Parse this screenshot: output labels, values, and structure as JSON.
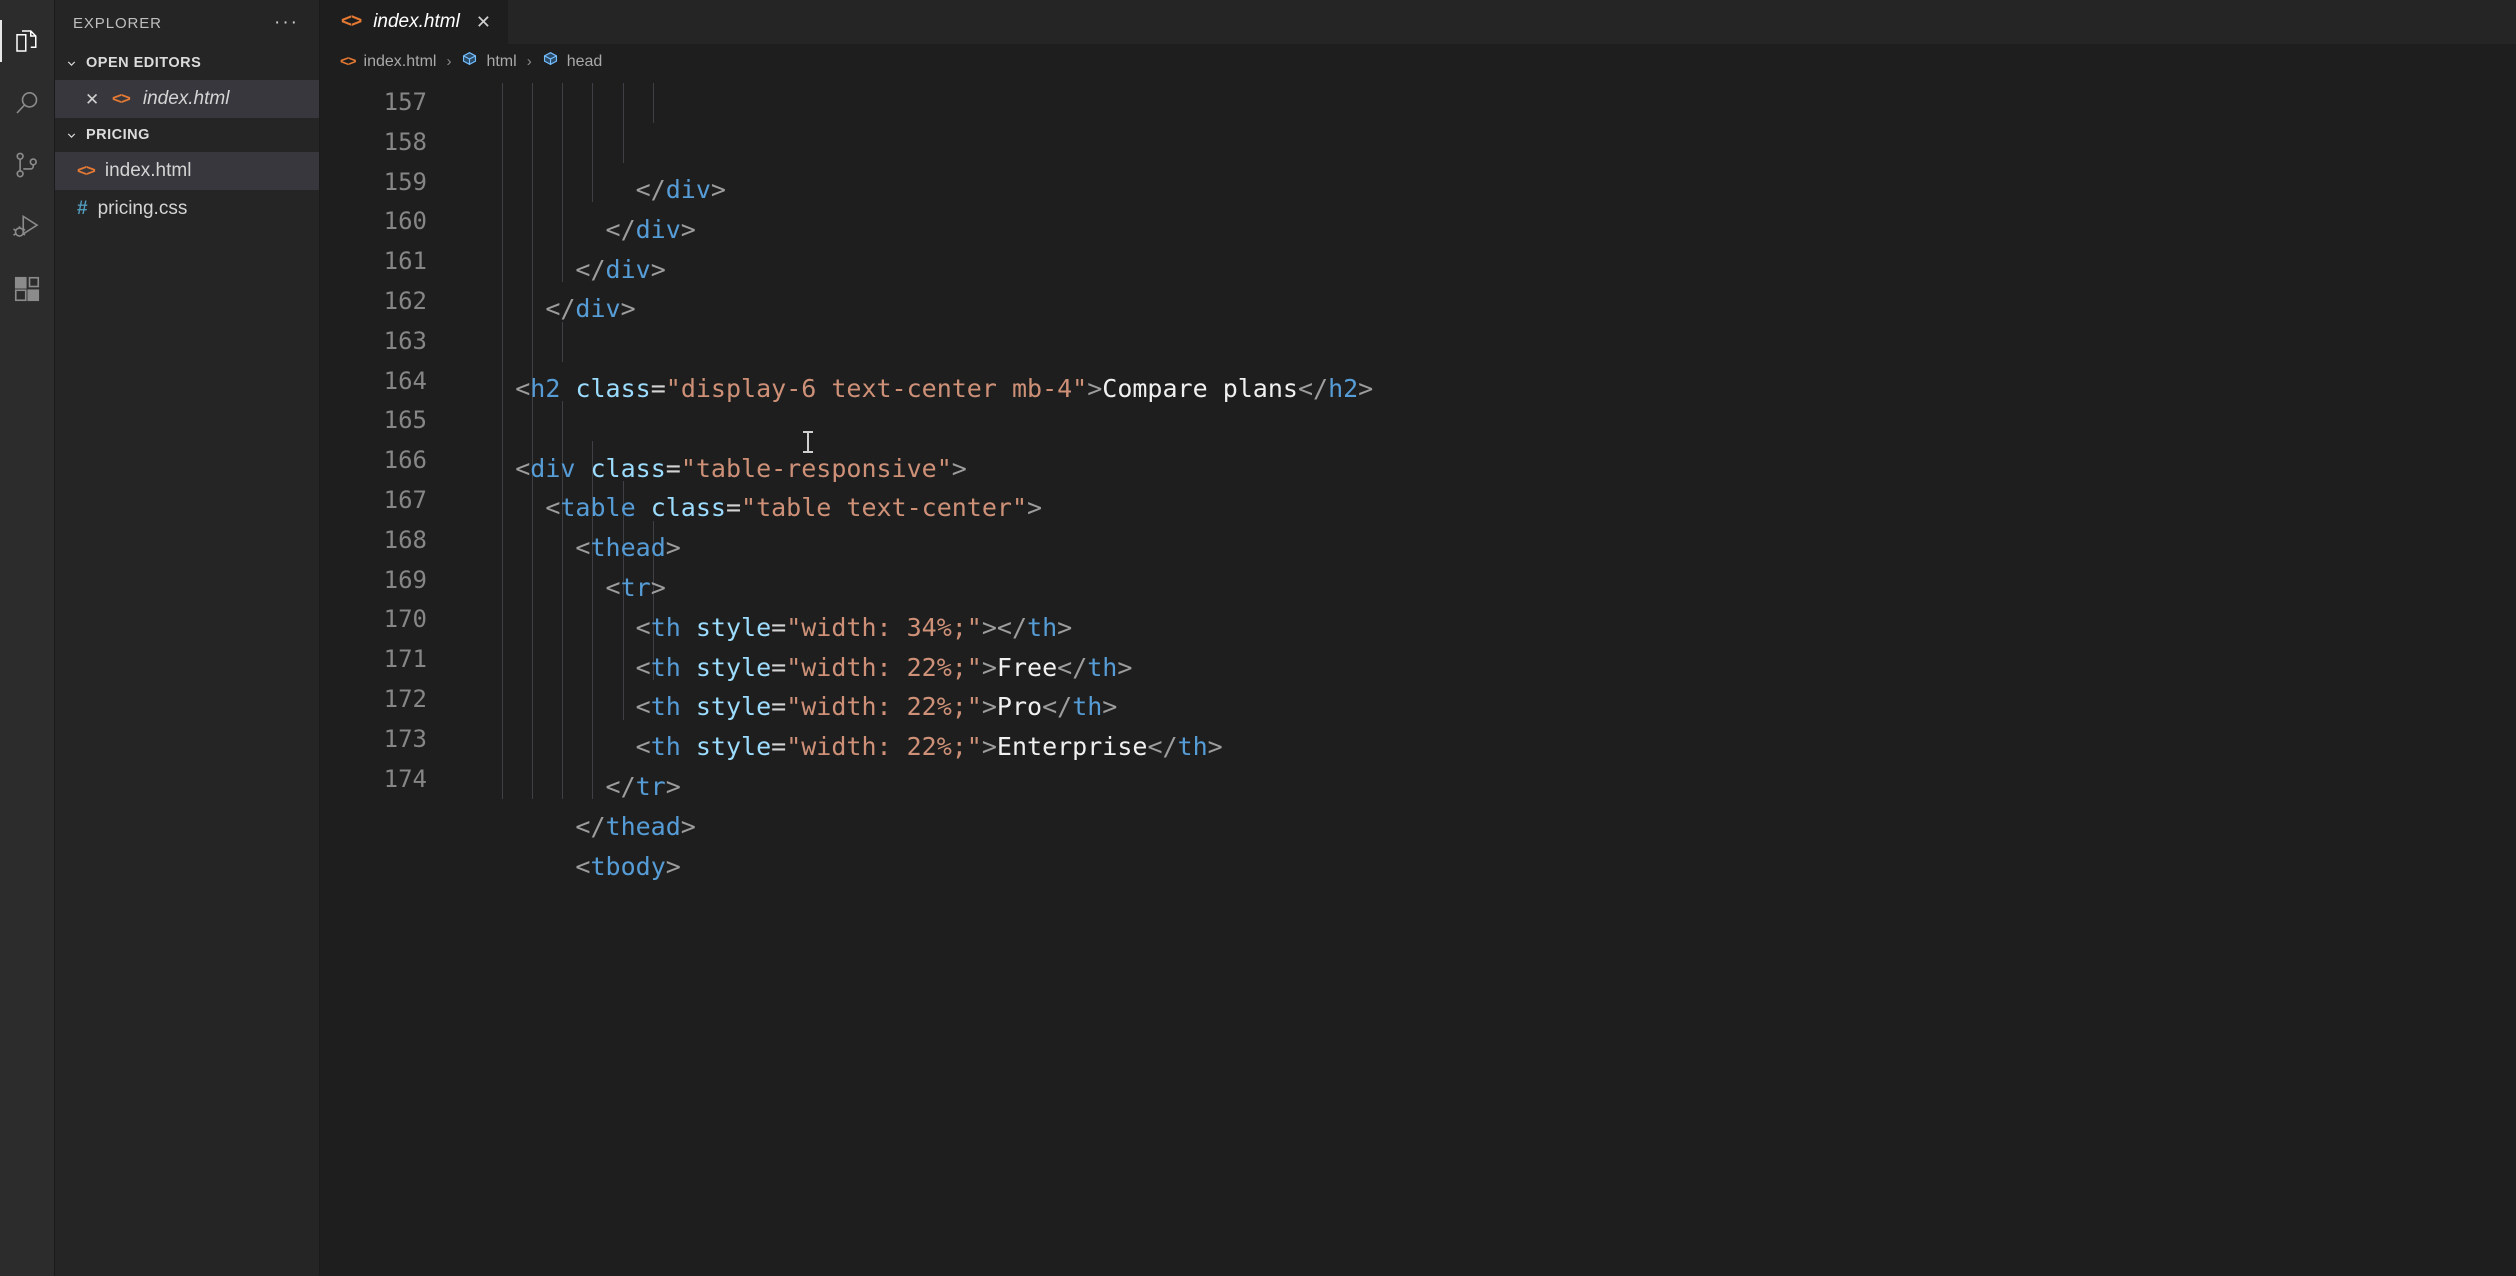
{
  "activitybar": {
    "items": [
      {
        "name": "explorer",
        "icon": "files-icon",
        "active": true
      },
      {
        "name": "search",
        "icon": "search-icon",
        "active": false
      },
      {
        "name": "source-control",
        "icon": "source-control-icon",
        "active": false
      },
      {
        "name": "run-and-debug",
        "icon": "run-debug-icon",
        "active": false
      },
      {
        "name": "extensions",
        "icon": "extensions-icon",
        "active": false
      }
    ]
  },
  "sidebar": {
    "title": "EXPLORER",
    "more_actions": "···",
    "sections": [
      {
        "label": "OPEN EDITORS",
        "expanded": true,
        "items": [
          {
            "label": "index.html",
            "icon": "html-file-icon",
            "close": "✕",
            "selected": true,
            "italic": true
          }
        ]
      },
      {
        "label": "PRICING",
        "expanded": true,
        "items": [
          {
            "label": "index.html",
            "icon": "html-file-icon",
            "selected": true
          },
          {
            "label": "pricing.css",
            "icon": "css-file-icon",
            "selected": false
          }
        ]
      }
    ]
  },
  "editor": {
    "tab": {
      "label": "index.html",
      "icon": "html-file-icon",
      "close": "✕",
      "dirty": false
    },
    "breadcrumb": [
      {
        "label": "index.html",
        "icon": "html-file-icon"
      },
      {
        "label": "html",
        "icon": "symbol-cube-icon"
      },
      {
        "label": "head",
        "icon": "symbol-cube-icon"
      }
    ],
    "breadcrumb_separator": "›",
    "language": "html",
    "first_visible_line": 157,
    "lines": [
      {
        "n": "157",
        "indent": 6,
        "tokens": [
          {
            "t": "brk",
            "v": "</"
          },
          {
            "t": "tag",
            "v": "div"
          },
          {
            "t": "brk",
            "v": ">"
          }
        ]
      },
      {
        "n": "158",
        "indent": 5,
        "tokens": [
          {
            "t": "brk",
            "v": "</"
          },
          {
            "t": "tag",
            "v": "div"
          },
          {
            "t": "brk",
            "v": ">"
          }
        ]
      },
      {
        "n": "159",
        "indent": 4,
        "tokens": [
          {
            "t": "brk",
            "v": "</"
          },
          {
            "t": "tag",
            "v": "div"
          },
          {
            "t": "brk",
            "v": ">"
          }
        ]
      },
      {
        "n": "160",
        "indent": 3,
        "tokens": [
          {
            "t": "brk",
            "v": "</"
          },
          {
            "t": "tag",
            "v": "div"
          },
          {
            "t": "brk",
            "v": ">"
          }
        ]
      },
      {
        "n": "161",
        "indent": 0,
        "tokens": []
      },
      {
        "n": "162",
        "indent": 2,
        "tokens": [
          {
            "t": "brk",
            "v": "<"
          },
          {
            "t": "tag",
            "v": "h2"
          },
          {
            "t": "eq",
            "v": " "
          },
          {
            "t": "attr",
            "v": "class"
          },
          {
            "t": "eq",
            "v": "="
          },
          {
            "t": "str",
            "v": "\"display-6 text-center mb-4\""
          },
          {
            "t": "brk",
            "v": ">"
          },
          {
            "t": "txt",
            "v": "Compare plans"
          },
          {
            "t": "brk",
            "v": "</"
          },
          {
            "t": "tag",
            "v": "h2"
          },
          {
            "t": "brk",
            "v": ">"
          }
        ]
      },
      {
        "n": "163",
        "indent": 0,
        "tokens": []
      },
      {
        "n": "164",
        "indent": 2,
        "tokens": [
          {
            "t": "brk",
            "v": "<"
          },
          {
            "t": "tag",
            "v": "div"
          },
          {
            "t": "eq",
            "v": " "
          },
          {
            "t": "attr",
            "v": "class"
          },
          {
            "t": "eq",
            "v": "="
          },
          {
            "t": "str",
            "v": "\"table-responsive\""
          },
          {
            "t": "brk",
            "v": ">"
          }
        ]
      },
      {
        "n": "165",
        "indent": 3,
        "tokens": [
          {
            "t": "brk",
            "v": "<"
          },
          {
            "t": "tag",
            "v": "table"
          },
          {
            "t": "eq",
            "v": " "
          },
          {
            "t": "attr",
            "v": "class"
          },
          {
            "t": "eq",
            "v": "="
          },
          {
            "t": "str",
            "v": "\"table text-center\""
          },
          {
            "t": "brk",
            "v": ">"
          }
        ]
      },
      {
        "n": "166",
        "indent": 4,
        "tokens": [
          {
            "t": "brk",
            "v": "<"
          },
          {
            "t": "tag",
            "v": "thead"
          },
          {
            "t": "brk",
            "v": ">"
          }
        ]
      },
      {
        "n": "167",
        "indent": 5,
        "tokens": [
          {
            "t": "brk",
            "v": "<"
          },
          {
            "t": "tag",
            "v": "tr"
          },
          {
            "t": "brk",
            "v": ">"
          }
        ]
      },
      {
        "n": "168",
        "indent": 6,
        "tokens": [
          {
            "t": "brk",
            "v": "<"
          },
          {
            "t": "tag",
            "v": "th"
          },
          {
            "t": "eq",
            "v": " "
          },
          {
            "t": "attr",
            "v": "style"
          },
          {
            "t": "eq",
            "v": "="
          },
          {
            "t": "str",
            "v": "\"width: 34%;\""
          },
          {
            "t": "brk",
            "v": ">"
          },
          {
            "t": "brk",
            "v": "</"
          },
          {
            "t": "tag",
            "v": "th"
          },
          {
            "t": "brk",
            "v": ">"
          }
        ]
      },
      {
        "n": "169",
        "indent": 6,
        "tokens": [
          {
            "t": "brk",
            "v": "<"
          },
          {
            "t": "tag",
            "v": "th"
          },
          {
            "t": "eq",
            "v": " "
          },
          {
            "t": "attr",
            "v": "style"
          },
          {
            "t": "eq",
            "v": "="
          },
          {
            "t": "str",
            "v": "\"width: 22%;\""
          },
          {
            "t": "brk",
            "v": ">"
          },
          {
            "t": "txt",
            "v": "Free"
          },
          {
            "t": "brk",
            "v": "</"
          },
          {
            "t": "tag",
            "v": "th"
          },
          {
            "t": "brk",
            "v": ">"
          }
        ]
      },
      {
        "n": "170",
        "indent": 6,
        "tokens": [
          {
            "t": "brk",
            "v": "<"
          },
          {
            "t": "tag",
            "v": "th"
          },
          {
            "t": "eq",
            "v": " "
          },
          {
            "t": "attr",
            "v": "style"
          },
          {
            "t": "eq",
            "v": "="
          },
          {
            "t": "str",
            "v": "\"width: 22%;\""
          },
          {
            "t": "brk",
            "v": ">"
          },
          {
            "t": "txt",
            "v": "Pro"
          },
          {
            "t": "brk",
            "v": "</"
          },
          {
            "t": "tag",
            "v": "th"
          },
          {
            "t": "brk",
            "v": ">"
          }
        ]
      },
      {
        "n": "171",
        "indent": 6,
        "tokens": [
          {
            "t": "brk",
            "v": "<"
          },
          {
            "t": "tag",
            "v": "th"
          },
          {
            "t": "eq",
            "v": " "
          },
          {
            "t": "attr",
            "v": "style"
          },
          {
            "t": "eq",
            "v": "="
          },
          {
            "t": "str",
            "v": "\"width: 22%;\""
          },
          {
            "t": "brk",
            "v": ">"
          },
          {
            "t": "txt",
            "v": "Enterprise"
          },
          {
            "t": "brk",
            "v": "</"
          },
          {
            "t": "tag",
            "v": "th"
          },
          {
            "t": "brk",
            "v": ">"
          }
        ]
      },
      {
        "n": "172",
        "indent": 5,
        "tokens": [
          {
            "t": "brk",
            "v": "</"
          },
          {
            "t": "tag",
            "v": "tr"
          },
          {
            "t": "brk",
            "v": ">"
          }
        ]
      },
      {
        "n": "173",
        "indent": 4,
        "tokens": [
          {
            "t": "brk",
            "v": "</"
          },
          {
            "t": "tag",
            "v": "thead"
          },
          {
            "t": "brk",
            "v": ">"
          }
        ]
      },
      {
        "n": "174",
        "indent": 4,
        "tokens": [
          {
            "t": "brk",
            "v": "<"
          },
          {
            "t": "tag",
            "v": "tbody"
          },
          {
            "t": "brk",
            "v": ">"
          }
        ]
      }
    ]
  },
  "colors": {
    "background": "#1e1e1e",
    "sidebar_bg": "#252526",
    "activitybar_bg": "#2c2c2c",
    "selection_bg": "#37373d",
    "tag": "#569cd6",
    "attribute": "#9cdcfe",
    "string": "#ce9178",
    "bracket": "#9d9d9d",
    "text": "#f0f0f0",
    "line_number": "#868686",
    "html_icon": "#e37933",
    "css_icon": "#519aba",
    "symbol_icon": "#75beff"
  }
}
